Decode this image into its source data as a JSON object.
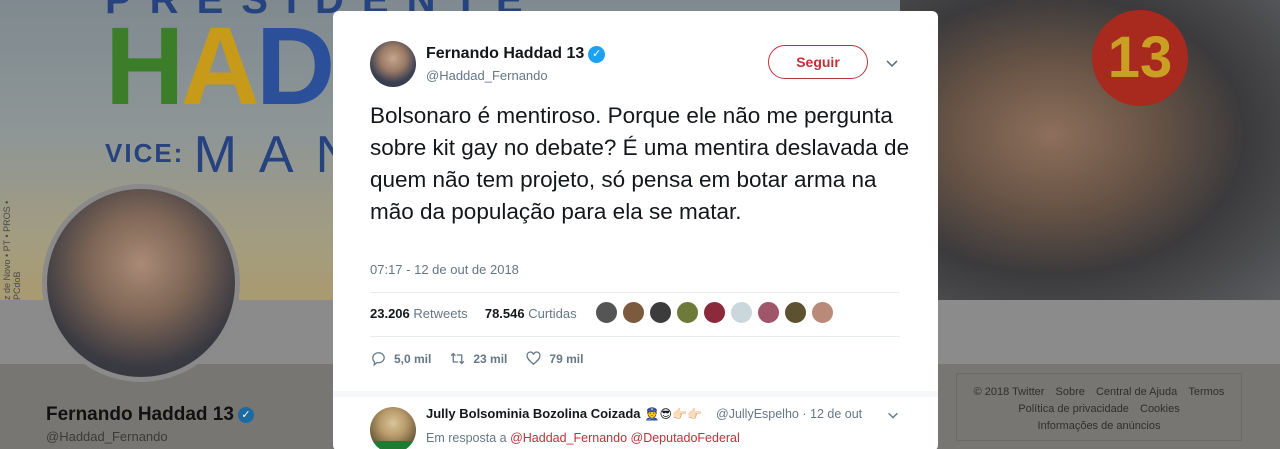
{
  "background": {
    "banner_top": "PRESIDENTE",
    "banner_name": "HAD",
    "banner_vice_label": "VICE:",
    "banner_vice_name": "MAN",
    "banner_number": "13",
    "side_text": "z de Novo • PT • PROS • PCdoB",
    "profile_name": "Fernando Haddad 13",
    "profile_handle": "@Haddad_Fernando",
    "footer": {
      "copyright": "© 2018 Twitter",
      "links": [
        "Sobre",
        "Central de Ajuda",
        "Termos",
        "Política de privacidade",
        "Cookies",
        "Informações de anúncios"
      ]
    }
  },
  "tweet": {
    "author_name": "Fernando Haddad 13",
    "author_handle": "@Haddad_Fernando",
    "follow_label": "Seguir",
    "text": "Bolsonaro é mentiroso. Porque ele não me pergunta sobre kit gay no debate? É uma mentira deslavada de quem não tem projeto, só pensa em botar arma na mão da população para ela se matar.",
    "timestamp": "07:17 - 12 de out de 2018",
    "retweets_count": "23.206",
    "retweets_label": "Retweets",
    "likes_count": "78.546",
    "likes_label": "Curtidas",
    "reply_count": "5,0 mil",
    "retweet_action_count": "23 mil",
    "like_action_count": "79 mil",
    "colors": {
      "accent": "#c0303a",
      "verified": "#1da1f2",
      "muted": "#657786"
    }
  },
  "reply": {
    "name": "Jully Bolsominia Bozolina Coizada",
    "emoji": "👮😎👉🏻👉🏻",
    "handle": "@JullyEspelho",
    "separator": "·",
    "date": "12 de out",
    "context_prefix": "Em resposta a",
    "mention_1": "@Haddad_Fernando",
    "mention_2": "@DeputadoFederal"
  }
}
